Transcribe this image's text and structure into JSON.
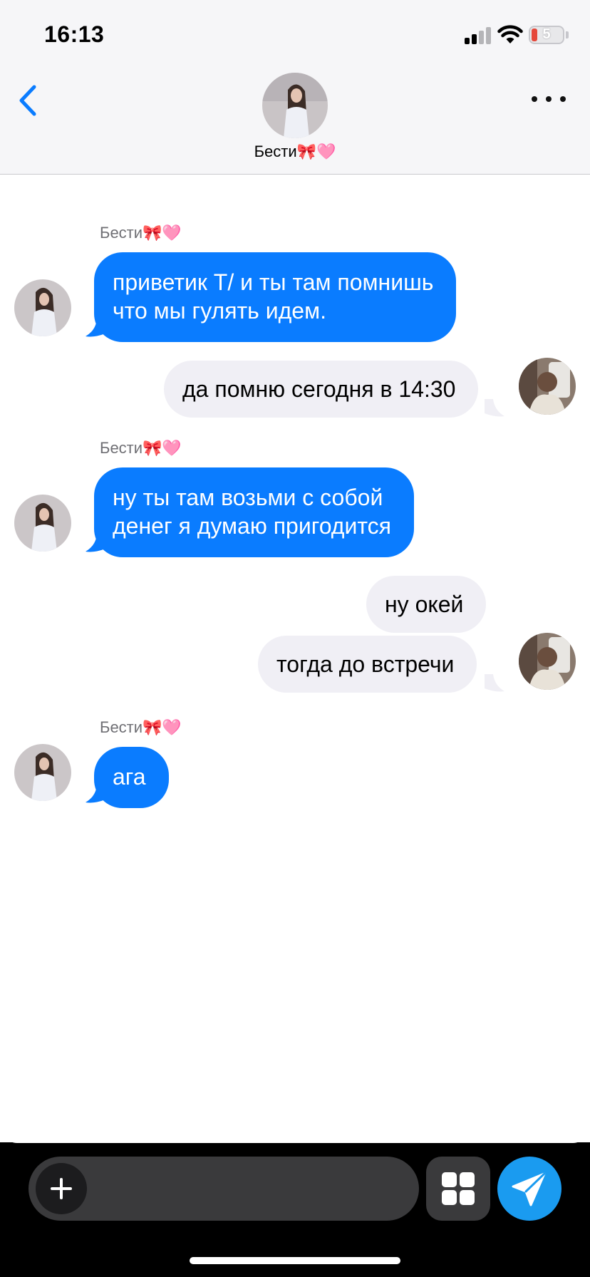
{
  "status_bar": {
    "time": "16:13",
    "battery_level": "5"
  },
  "header": {
    "back_icon": "chevron-left-icon",
    "contact_name": "Бести🎀🩷",
    "more_icon": "ellipsis-icon"
  },
  "messages": [
    {
      "direction": "incoming",
      "sender": "Бести🎀🩷",
      "lines": [
        "приветик Т/ и ты там помнишь",
        "что мы гулять идем."
      ]
    },
    {
      "direction": "outgoing",
      "lines": [
        "да помню сегодня в 14:30"
      ]
    },
    {
      "direction": "incoming",
      "sender": "Бести🎀🩷",
      "lines": [
        "ну ты там возьми с собой",
        "денег я думаю пригодится"
      ]
    },
    {
      "direction": "outgoing",
      "lines": [
        "ну окей"
      ]
    },
    {
      "direction": "outgoing",
      "lines": [
        "тогда до встречи"
      ]
    },
    {
      "direction": "incoming",
      "sender": "Бести🎀🩷",
      "lines": [
        "ага"
      ]
    }
  ],
  "composer": {
    "message_value": "",
    "add_icon": "plus-icon",
    "apps_icon": "grid-icon",
    "send_icon": "paper-plane-icon"
  },
  "colors": {
    "incoming_bubble": "#0a7cff",
    "outgoing_bubble": "#f0eff5",
    "send_button": "#1a9bf0",
    "back_chevron": "#0a7cff"
  }
}
